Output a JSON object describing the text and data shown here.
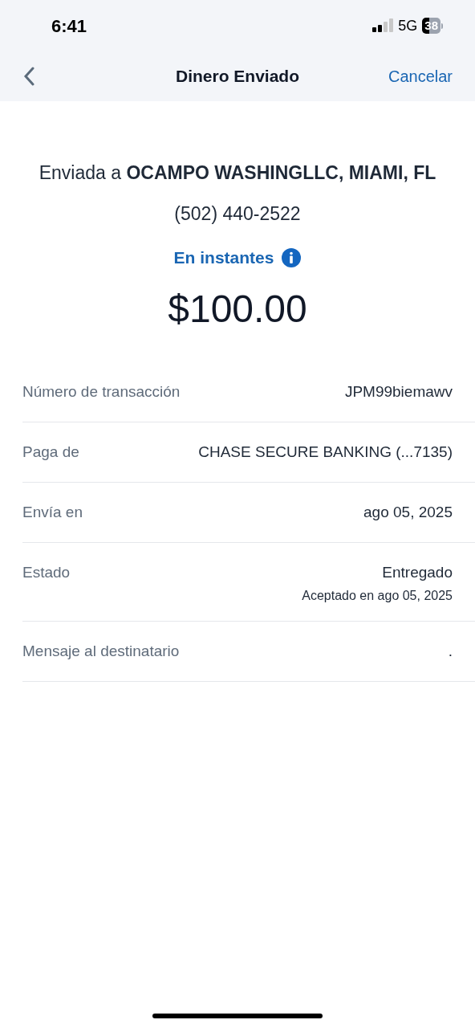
{
  "status_bar": {
    "time": "6:41",
    "network": "5G",
    "battery": "38"
  },
  "nav": {
    "title": "Dinero Enviado",
    "cancel": "Cancelar"
  },
  "summary": {
    "recipient": "Enviada a **OCAMPO WASHINGLLC, MIAMI, FL**",
    "phone": "(502) 440-2522",
    "speed": "En instantes",
    "amount": "$100.00"
  },
  "details": [
    {
      "label": "Número de transacción",
      "value": "JPM99biemawv"
    },
    {
      "label": "Paga de",
      "value": "CHASE SECURE BANKING (...7135)"
    },
    {
      "label": "Envía en",
      "value": "ago 05, 2025"
    },
    {
      "label": "Estado",
      "value": "Entregado",
      "note": "Aceptado en ago 05, 2025"
    },
    {
      "label": "Mensaje al destinatario",
      "value": "."
    }
  ]
}
